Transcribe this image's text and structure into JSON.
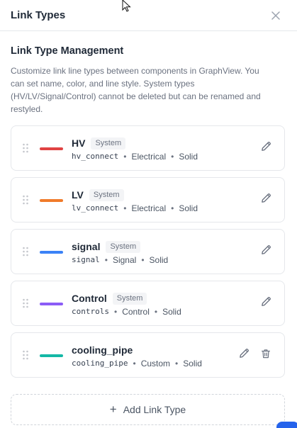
{
  "panel": {
    "title": "Link Types",
    "close_icon": "close-icon"
  },
  "section": {
    "title": "Link Type Management",
    "description": "Customize link line types between components in GraphView. You can set name, color, and line style. System types (HV/LV/Signal/Control) cannot be deleted but can be renamed and restyled."
  },
  "link_types": [
    {
      "name": "HV",
      "badge": "System",
      "id": "hv_connect",
      "category": "Electrical",
      "style": "Solid",
      "color": "#e04343",
      "deletable": false
    },
    {
      "name": "LV",
      "badge": "System",
      "id": "lv_connect",
      "category": "Electrical",
      "style": "Solid",
      "color": "#f07b2a",
      "deletable": false
    },
    {
      "name": "signal",
      "badge": "System",
      "id": "signal",
      "category": "Signal",
      "style": "Solid",
      "color": "#3b82f6",
      "deletable": false
    },
    {
      "name": "Control",
      "badge": "System",
      "id": "controls",
      "category": "Control",
      "style": "Solid",
      "color": "#8b5cf6",
      "deletable": false
    },
    {
      "name": "cooling_pipe",
      "badge": "",
      "id": "cooling_pipe",
      "category": "Custom",
      "style": "Solid",
      "color": "#14b8a6",
      "deletable": true
    }
  ],
  "separator": "•",
  "add_button": {
    "label": "Add Link Type",
    "icon": "plus-icon"
  }
}
